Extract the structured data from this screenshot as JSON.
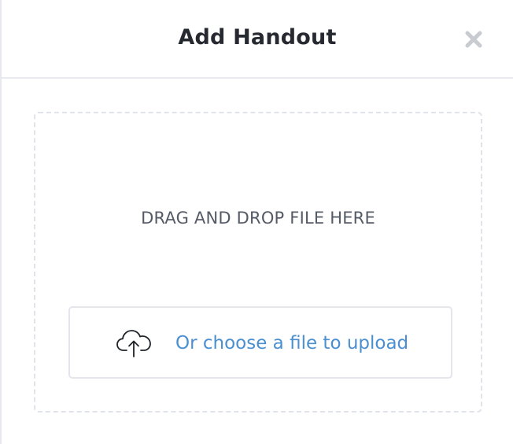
{
  "modal": {
    "title": "Add Handout",
    "close_icon": "close-x-icon"
  },
  "drop_zone": {
    "instruction": "DRAG AND DROP FILE HERE"
  },
  "upload": {
    "label": "Or choose a file to upload",
    "icon": "cloud-upload-icon"
  },
  "colors": {
    "link_blue": "#4a8fd0",
    "title_text": "#262a30",
    "body_text": "#545b66",
    "border": "#e4e6ec",
    "close_icon": "#c8cbd0"
  }
}
